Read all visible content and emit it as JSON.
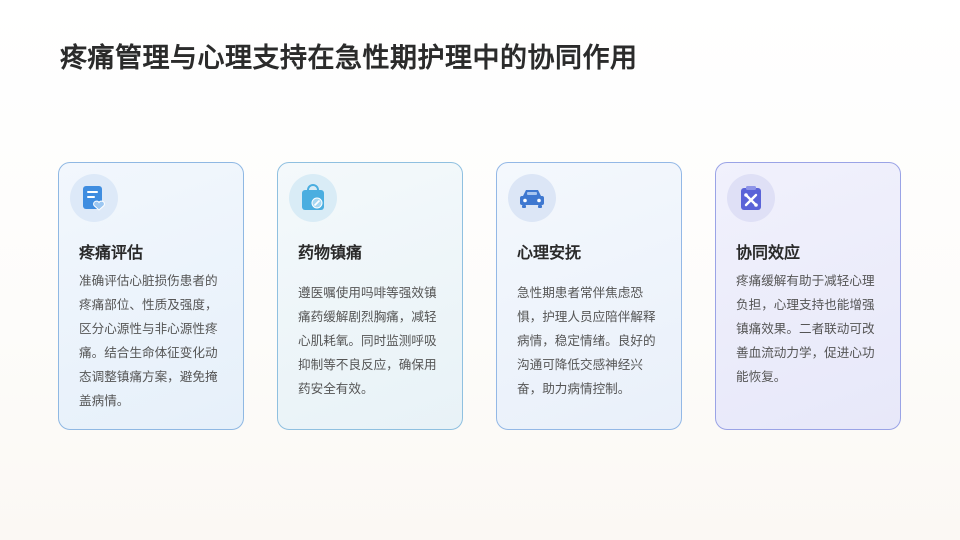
{
  "page": {
    "title": "疼痛管理与心理支持在急性期护理中的协同作用"
  },
  "cards": [
    {
      "icon": "document-heart-icon",
      "title": "疼痛评估",
      "text": "准确评估心脏损伤患者的疼痛部位、性质及强度，区分心源性与非心源性疼痛。结合生命体征变化动态调整镇痛方案，避免掩盖病情。"
    },
    {
      "icon": "medicine-bag-icon",
      "title": "药物镇痛",
      "text": "遵医嘱使用吗啡等强效镇痛药缓解剧烈胸痛，减轻心肌耗氧。同时监测呼吸抑制等不良反应，确保用药安全有效。"
    },
    {
      "icon": "car-icon",
      "title": "心理安抚",
      "text": "急性期患者常伴焦虑恐惧，护理人员应陪伴解释病情，稳定情绪。良好的沟通可降低交感神经兴奋，助力病情控制。"
    },
    {
      "icon": "clipboard-tools-icon",
      "title": "协同效应",
      "text": "疼痛缓解有助于减轻心理负担，心理支持也能增强镇痛效果。二者联动可改善血流动力学，促进心功能恢复。"
    }
  ],
  "colors": {
    "icon_blue": "#3f8de0",
    "icon_cyan": "#4aaee0",
    "icon_indigo": "#5a63d8"
  }
}
